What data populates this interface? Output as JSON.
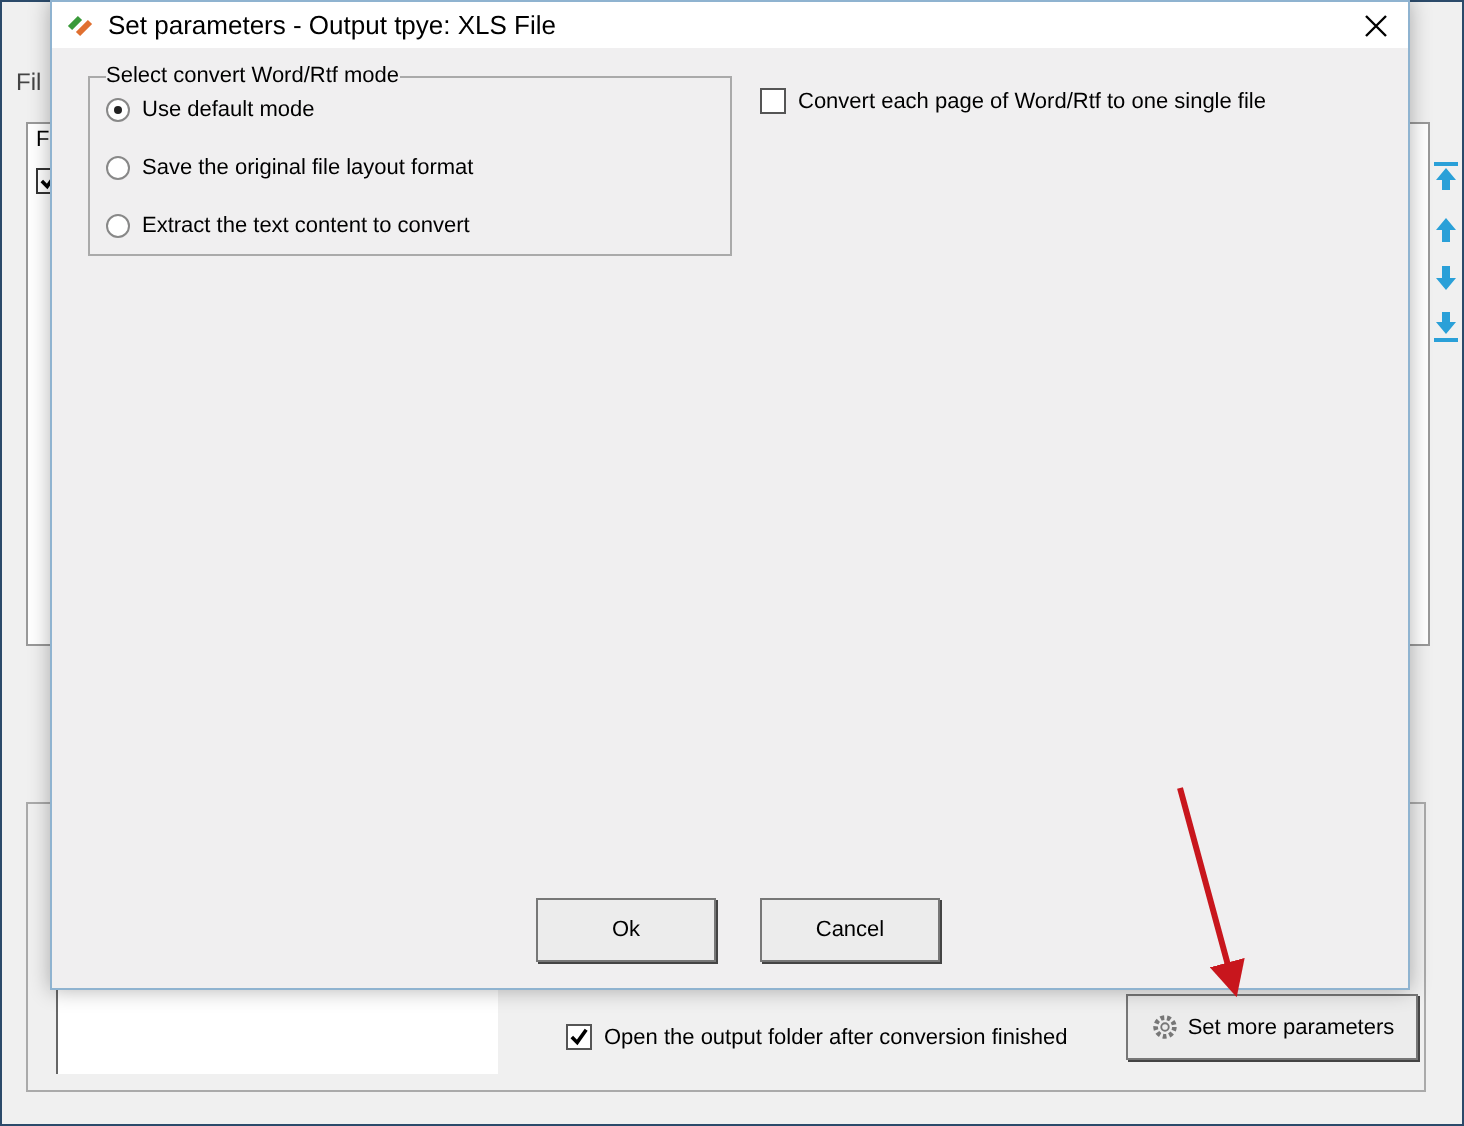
{
  "main_window": {
    "menu": "Fil",
    "list_header": "F",
    "list_row_checked": true,
    "output_options": [
      {
        "label": "Open the output folder after conversion finished",
        "checked": true
      }
    ],
    "more_button": "Set more parameters"
  },
  "dialog": {
    "title": "Set parameters - Output tpye: XLS File",
    "mode_group": {
      "title": "Select convert Word/Rtf mode",
      "options": [
        {
          "label": "Use default mode",
          "selected": true
        },
        {
          "label": "Save the original file layout format",
          "selected": false
        },
        {
          "label": "Extract the text content to convert",
          "selected": false
        }
      ]
    },
    "split_option": {
      "label": "Convert each page of Word/Rtf to one single file",
      "checked": false
    },
    "buttons": [
      "Ok",
      "Cancel"
    ]
  }
}
